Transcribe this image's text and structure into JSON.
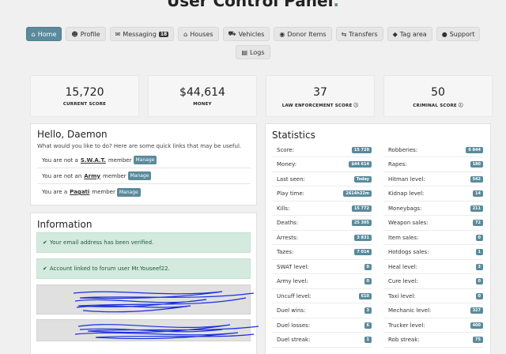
{
  "header": {
    "title": "User Control Panel",
    "dot": "."
  },
  "nav": {
    "home": "Home",
    "profile": "Profile",
    "messaging": "Messaging",
    "messaging_count": "18",
    "houses": "Houses",
    "vehicles": "Vehicles",
    "donor_items": "Donor Items",
    "transfers": "Transfers",
    "tag_area": "Tag area",
    "support": "Support",
    "logs": "Logs"
  },
  "icons": {
    "home": "home-icon",
    "profile": "user-icon",
    "messaging": "envelope-icon",
    "houses": "home-icon",
    "vehicles": "car-icon",
    "donor_items": "gamepad-icon",
    "transfers": "arrows-icon",
    "tag_area": "tag-icon",
    "support": "chat-icon",
    "logs": "file-icon",
    "verified": "check-circle-icon",
    "help": "question-circle-icon"
  },
  "accent": "#5a8a9c",
  "stats_cards": [
    {
      "value": "15,720",
      "label": "CURRENT SCORE"
    },
    {
      "value": "$44,614",
      "label": "MONEY"
    },
    {
      "value": "37",
      "label": "LAW ENFORCEMENT SCORE ⓘ"
    },
    {
      "value": "50",
      "label": "CRIMINAL SCORE ⓘ"
    }
  ],
  "hello": {
    "title": "Hello, Daemon",
    "subtitle": "What would you like to do? Here are some quick links that may be useful.",
    "rows": [
      {
        "pre": "You are not a",
        "group": "S.W.A.T.",
        "post": "member",
        "button": "Manage"
      },
      {
        "pre": "You are not an",
        "group": "Army",
        "post": "member",
        "button": "Manage"
      },
      {
        "pre": "You are a",
        "group": "Pagati",
        "post": "member",
        "button": "Manage"
      }
    ]
  },
  "information": {
    "title": "Information",
    "email_verified": "Your email address has been verified.",
    "forum_linked": "Account linked to forum user Mr.Youseef22.",
    "redacted_1": "",
    "redacted_2": ""
  },
  "statistics": {
    "title": "Statistics",
    "left": [
      {
        "label": "Score:",
        "value": "15 720"
      },
      {
        "label": "Money:",
        "value": "$44 614"
      },
      {
        "label": "Last seen:",
        "value": "Today"
      },
      {
        "label": "Play time:",
        "value": "2614h22m"
      },
      {
        "label": "Kills:",
        "value": "15 772"
      },
      {
        "label": "Deaths:",
        "value": "25 305"
      },
      {
        "label": "Arrests:",
        "value": "3 831"
      },
      {
        "label": "Tazes:",
        "value": "7 014"
      },
      {
        "label": "SWAT level:",
        "value": "0"
      },
      {
        "label": "Army level:",
        "value": "0"
      },
      {
        "label": "Uncuff level:",
        "value": "610"
      },
      {
        "label": "Duel wins:",
        "value": "3"
      },
      {
        "label": "Duel losses:",
        "value": "6"
      },
      {
        "label": "Duel streak:",
        "value": "1"
      }
    ],
    "right": [
      {
        "label": "Robberies:",
        "value": "6 844"
      },
      {
        "label": "Rapes:",
        "value": "180"
      },
      {
        "label": "Hitman level:",
        "value": "542"
      },
      {
        "label": "Kidnap level:",
        "value": "14"
      },
      {
        "label": "Moneybags:",
        "value": "211"
      },
      {
        "label": "Weapon sales:",
        "value": "72"
      },
      {
        "label": "Item sales:",
        "value": "0"
      },
      {
        "label": "Hotdogs sales:",
        "value": "1"
      },
      {
        "label": "Heal level:",
        "value": "3"
      },
      {
        "label": "Cure level:",
        "value": "0"
      },
      {
        "label": "Taxi level:",
        "value": "0"
      },
      {
        "label": "Mechanic level:",
        "value": "327"
      },
      {
        "label": "Trucker level:",
        "value": "400"
      },
      {
        "label": "Rob streak:",
        "value": "75"
      }
    ]
  }
}
